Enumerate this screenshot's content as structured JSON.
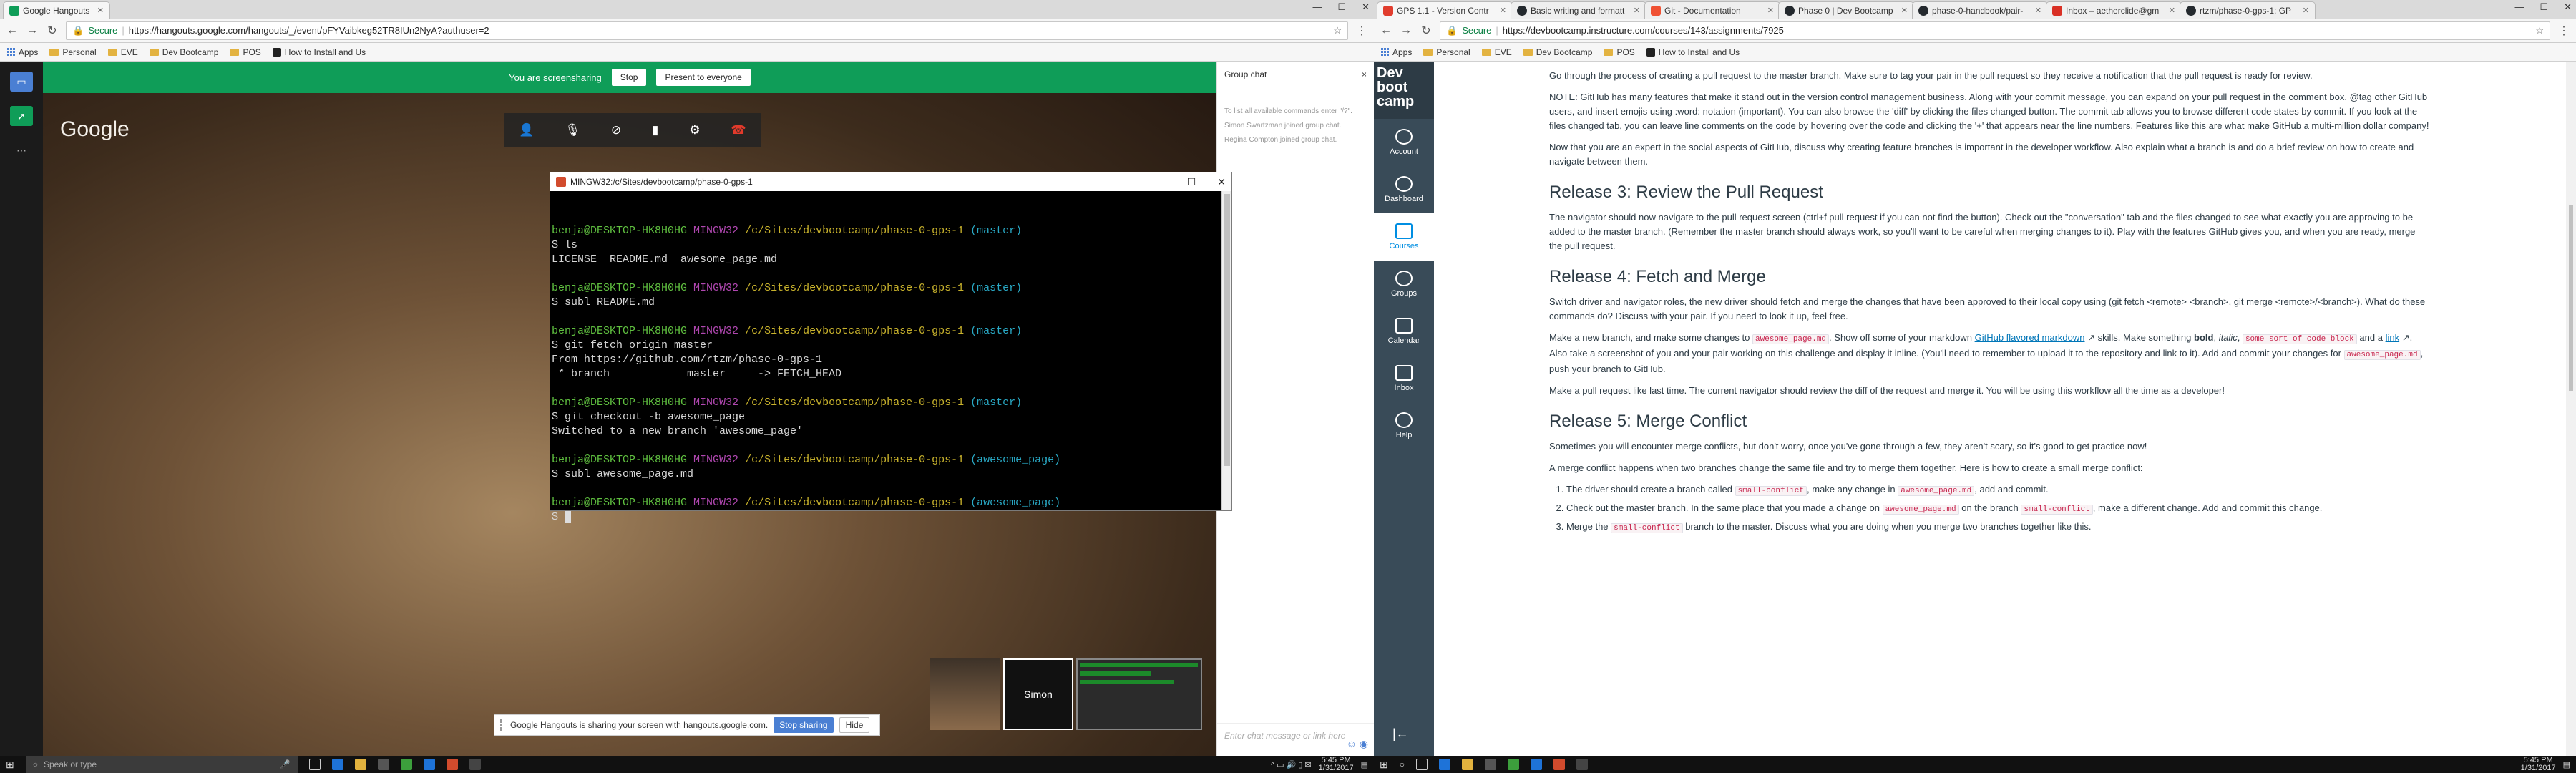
{
  "left": {
    "tabs": [
      {
        "title": "Google Hangouts",
        "color": "#0f9d58"
      }
    ],
    "address": {
      "secure": "Secure",
      "url": "https://hangouts.google.com/hangouts/_/event/pFYVaibkeg52TR8IUn2NyA?authuser=2"
    },
    "bookmarks": [
      "Apps",
      "Personal",
      "EVE",
      "Dev Bootcamp",
      "POS",
      "How to Install and Us"
    ],
    "sharebar": {
      "text": "You are screensharing",
      "stop": "Stop",
      "present": "Present to everyone"
    },
    "logo": "Google",
    "chat": {
      "title": "Group chat",
      "close": "×",
      "messages": [
        "To list all available commands enter \"/?\".",
        "Simon Swartzman joined group chat.",
        "Regina Compton joined group chat."
      ],
      "placeholder": "Enter chat message or link here"
    },
    "participants": {
      "self_label": "Simon"
    },
    "notice": {
      "text": "Google Hangouts is sharing your screen with hangouts.google.com.",
      "stop": "Stop sharing",
      "hide": "Hide"
    },
    "terminal": {
      "title": "MINGW32:/c/Sites/devbootcamp/phase-0-gps-1",
      "user": "benja@DESKTOP-HK8H0HG",
      "path": "/c/Sites/devbootcamp/phase-0-gps-1",
      "branch_master": "(master)",
      "branch_feature": "(awesome_page)",
      "cmd_ls": "$ ls",
      "out_ls": "LICENSE  README.md  awesome_page.md",
      "cmd_subl1": "$ subl README.md",
      "cmd_fetch": "$ git fetch origin master",
      "out_fetch1": "From https://github.com/rtzm/phase-0-gps-1",
      "out_fetch2": " * branch            master     -> FETCH_HEAD",
      "cmd_checkout": "$ git checkout -b awesome_page",
      "out_checkout": "Switched to a new branch 'awesome_page'",
      "cmd_subl2": "$ subl awesome_page.md",
      "prompt_end": "$ "
    },
    "taskbar": {
      "search": "Speak or type",
      "time": "5:45 PM",
      "date": "1/31/2017"
    }
  },
  "right": {
    "tabs": [
      {
        "title": "GPS 1.1 - Version Contr",
        "color": "#e13d2e"
      },
      {
        "title": "Basic writing and formatt",
        "color": "#24292e"
      },
      {
        "title": "Git - Documentation",
        "color": "#f05133"
      },
      {
        "title": "Phase 0 | Dev Bootcamp",
        "color": "#24292e"
      },
      {
        "title": "phase-0-handbook/pair-",
        "color": "#24292e"
      },
      {
        "title": "Inbox – aetherclide@gm",
        "color": "#d93025"
      },
      {
        "title": "rtzm/phase-0-gps-1: GP",
        "color": "#24292e"
      }
    ],
    "address": {
      "secure": "Secure",
      "url": "https://devbootcamp.instructure.com/courses/143/assignments/7925"
    },
    "bookmarks": [
      "Apps",
      "Personal",
      "EVE",
      "Dev Bootcamp",
      "POS",
      "How to Install and Us"
    ],
    "nav": {
      "logo": "Dev boot camp",
      "items": [
        "Account",
        "Dashboard",
        "Courses",
        "Groups",
        "Calendar",
        "Inbox",
        "Help"
      ]
    },
    "content": {
      "p1": "Go through the process of creating a pull request to the master branch. Make sure to tag your pair in the pull request so they receive a notification that the pull request is ready for review.",
      "p2": "NOTE: GitHub has many features that make it stand out in the version control management business. Along with your commit message, you can expand on your pull request in the comment box. @tag other GitHub users, and insert emojis using :word: notation (important). You can also browse the 'diff' by clicking the files changed button. The commit tab allows you to browse different code states by commit. If you look at the files changed tab, you can leave line comments on the code by hovering over the code and clicking the '+' that appears near the line numbers. Features like this are what make GitHub a multi-million dollar company!",
      "p3": "Now that you are an expert in the social aspects of GitHub, discuss why creating feature branches is important in the developer workflow. Also explain what a branch is and do a brief review on how to create and navigate between them.",
      "h3": "Release 3: Review the Pull Request",
      "p4": "The navigator should now navigate to the pull request screen (ctrl+f pull request if you can not find the button). Check out the \"conversation\" tab and the files changed to see what exactly you are approving to be added to the master branch. (Remember the master branch should always work, so you'll want to be careful when merging changes to it). Play with the features GitHub gives you, and when you are ready, merge the pull request.",
      "h4": "Release 4: Fetch and Merge",
      "p5": "Switch driver and navigator roles, the new driver should fetch and merge the changes that have been approved to their local copy using (git fetch <remote> <branch>, git merge <remote>/<branch>). What do these commands do? Discuss with your pair. If you need to look it up, feel free.",
      "p6a": "Make a new branch, and make some changes to",
      "p6code1": "awesome_page.md",
      "p6b": ". Show off some of your markdown",
      "p6link1": "GitHub flavored markdown",
      "p6c": "skills. Make something",
      "p6bold": "bold",
      "p6italic": "italic",
      "p6code2": "some sort of code block",
      "p6d": "and a",
      "p6link2": "link",
      "p6e": ". Also take a screenshot of you and your pair working on this challenge and display it inline. (You'll need to remember to upload it to the repository and link to it). Add and commit your changes for",
      "p6code3": "awesome_page.md",
      "p6f": ", push your branch to GitHub.",
      "p7": "Make a pull request like last time. The current navigator should review the diff of the request and merge it. You will be using this workflow all the time as a developer!",
      "h5": "Release 5: Merge Conflict",
      "p8": "Sometimes you will encounter merge conflicts, but don't worry, once you've gone through a few, they aren't scary, so it's good to get practice now!",
      "p9": "A merge conflict happens when two branches change the same file and try to merge them together. Here is how to create a small merge conflict:",
      "li1a": "The driver should create a branch called",
      "li1code": "small-conflict",
      "li1b": ", make any change in",
      "li1code2": "awesome_page.md",
      "li1c": ", add and commit.",
      "li2a": "Check out the master branch. In the same place that you made a change on",
      "li2code": "awesome_page.md",
      "li2b": "on the branch",
      "li2code2": "small-conflict",
      "li2c": ", make a different change. Add and commit this change.",
      "li3a": "Merge the",
      "li3code": "small-conflict",
      "li3b": "branch to the master. Discuss what you are doing when you merge two branches together like this."
    },
    "taskbar": {
      "time": "5:45 PM",
      "date": "1/31/2017"
    }
  }
}
